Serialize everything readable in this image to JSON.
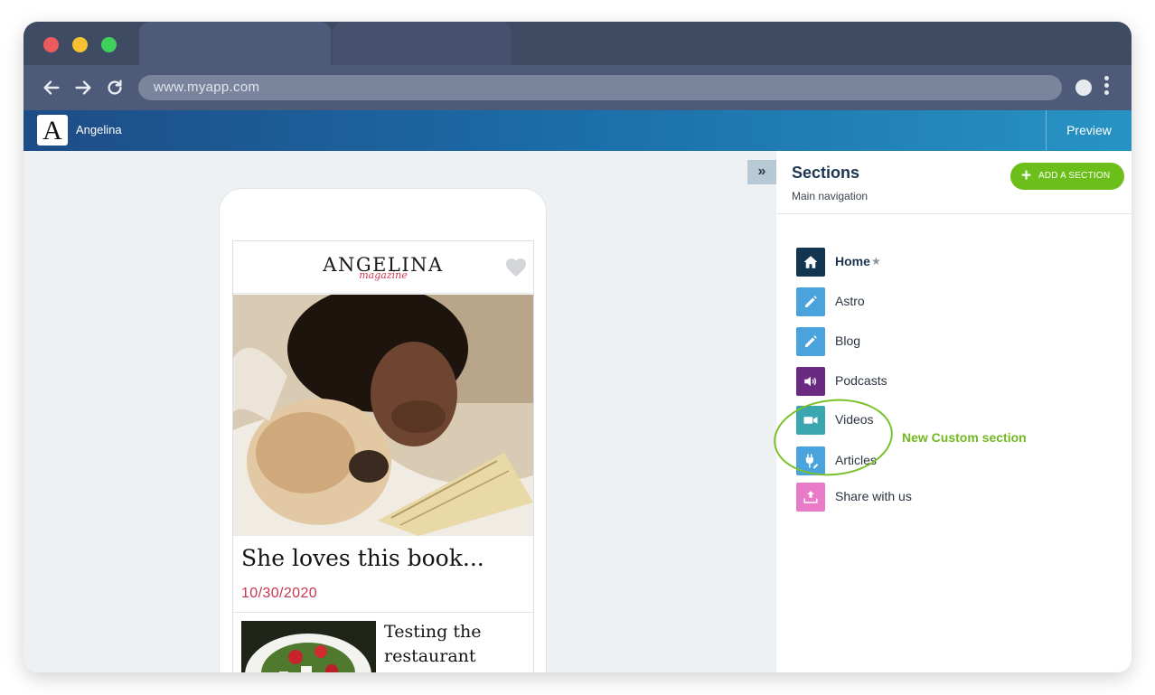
{
  "browser": {
    "url": "www.myapp.com"
  },
  "app": {
    "logo_letter": "A",
    "name": "Angelina",
    "preview_label": "Preview",
    "collapse_label": "»"
  },
  "phone": {
    "logo": "ANGELINA",
    "logo_sub": "magazine",
    "articles": [
      {
        "title": "She loves this book...",
        "date": "10/30/2020"
      },
      {
        "title": "Testing the restaurant Dolce"
      }
    ]
  },
  "sections_panel": {
    "title": "Sections",
    "subtitle": "Main navigation",
    "add_button": "ADD A SECTION",
    "add_icon": "+",
    "star": "★",
    "items": [
      {
        "label": "Home",
        "icon": "home-icon",
        "color": "#12364f",
        "default": true
      },
      {
        "label": "Astro",
        "icon": "pencil-icon",
        "color": "#4aa3dc"
      },
      {
        "label": "Blog",
        "icon": "pencil-icon",
        "color": "#4aa3dc"
      },
      {
        "label": "Podcasts",
        "icon": "speaker-icon",
        "color": "#6a2a82"
      },
      {
        "label": "Videos",
        "icon": "video-camera-icon",
        "color": "#3aa6b0"
      },
      {
        "label": "Articles",
        "icon": "plug-icon",
        "color": "#4aa3dc"
      },
      {
        "label": "Share with us",
        "icon": "upload-icon",
        "color": "#e97ac7"
      }
    ],
    "annotation": "New Custom section",
    "annotation_color": "#72b81f"
  }
}
